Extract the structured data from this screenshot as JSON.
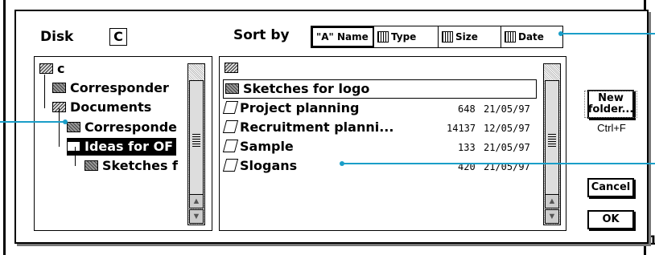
{
  "disk": {
    "label": "Disk",
    "value": "C"
  },
  "sort": {
    "label": "Sort by",
    "options": [
      {
        "label": "\"A\" Name",
        "icon": "name-sort-icon",
        "active": true
      },
      {
        "label": "Type",
        "icon": "type-sort-icon"
      },
      {
        "label": "Size",
        "icon": "size-sort-icon"
      },
      {
        "label": "Date",
        "icon": "date-sort-icon"
      }
    ]
  },
  "tree": {
    "items": [
      {
        "label": "c",
        "icon": "open-folder-icon"
      },
      {
        "label": "Corresponder",
        "icon": "folder-icon"
      },
      {
        "label": "Documents",
        "icon": "open-folder-icon"
      },
      {
        "label": "Corresponde",
        "icon": "folder-icon"
      },
      {
        "label": "Ideas for OF",
        "icon": "open-folder-icon",
        "selected": true
      },
      {
        "label": "Sketches f",
        "icon": "folder-icon"
      }
    ]
  },
  "files": {
    "items": [
      {
        "name": "Sketches for logo",
        "icon": "folder-icon",
        "size": "",
        "date": "",
        "focused": true
      },
      {
        "name": "Project planning",
        "icon": "document-icon",
        "size": "648",
        "date": "21/05/97"
      },
      {
        "name": "Recruitment planni...",
        "icon": "document-icon",
        "size": "14137",
        "date": "12/05/97"
      },
      {
        "name": "Sample",
        "icon": "document-icon",
        "size": "133",
        "date": "21/05/97"
      },
      {
        "name": "Slogans",
        "icon": "document-icon",
        "size": "420",
        "date": "21/05/97"
      }
    ]
  },
  "buttons": {
    "new_folder_line1": "New",
    "new_folder_line2": "folder...",
    "new_folder_shortcut": "Ctrl+F",
    "cancel": "Cancel",
    "ok": "OK"
  },
  "edge_label": "1",
  "colors": {
    "callout": "#1a9ec8"
  }
}
